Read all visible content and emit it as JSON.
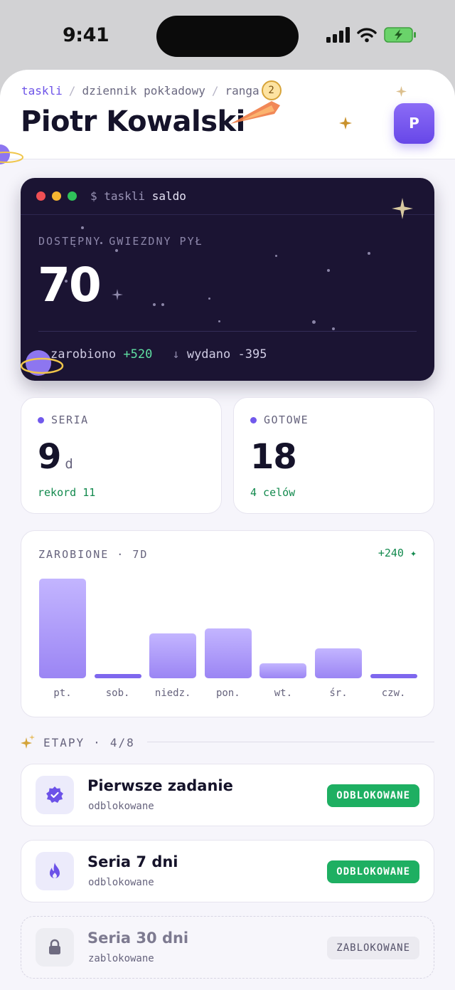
{
  "status": {
    "time": "9:41"
  },
  "breadcrumb": [
    {
      "label": "taskli"
    },
    {
      "label": "dziennik pokładowy"
    },
    {
      "label": "ranga"
    }
  ],
  "rank_level": "2",
  "page_title": "Piotr Kowalski",
  "avatar_letter": "P",
  "balance": {
    "command_prefix": "$ taskli",
    "command": "saldo",
    "label": "DOSTĘPNY GWIEZDNY PYŁ",
    "value": "70",
    "earned_label": "zarobiono",
    "earned_value": "+520",
    "spent_label": "wydano",
    "spent_value": "-395"
  },
  "stats": {
    "streak": {
      "label": "SERIA",
      "value": "9",
      "unit": "d",
      "sub": "rekord 11"
    },
    "done": {
      "label": "GOTOWE",
      "value": "18",
      "sub": "4 celów"
    }
  },
  "chart_data": {
    "type": "bar",
    "title": "ZAROBIONE · 7D",
    "delta": "+240",
    "categories": [
      "pt.",
      "sob.",
      "niedz.",
      "pon.",
      "wt.",
      "śr.",
      "czw."
    ],
    "values": [
      140,
      6,
      63,
      70,
      21,
      42,
      6
    ],
    "ylim": [
      0,
      140
    ]
  },
  "milestones": {
    "label": "ETAPY",
    "progress": "4/8",
    "items": [
      {
        "title": "Pierwsze zadanie",
        "sub": "odblokowane",
        "status": "ODBLOKOWANE",
        "icon": "badge-check-icon",
        "locked": false
      },
      {
        "title": "Seria 7 dni",
        "sub": "odblokowane",
        "status": "ODBLOKOWANE",
        "icon": "flame-icon",
        "locked": false
      },
      {
        "title": "Seria 30 dni",
        "sub": "zablokowane",
        "status": "ZABLOKOWANE",
        "icon": "lock-icon",
        "locked": true
      }
    ]
  },
  "colors": {
    "accent": "#6c52e8",
    "success": "#1eaf62",
    "terminal_bg": "#1b1433"
  }
}
